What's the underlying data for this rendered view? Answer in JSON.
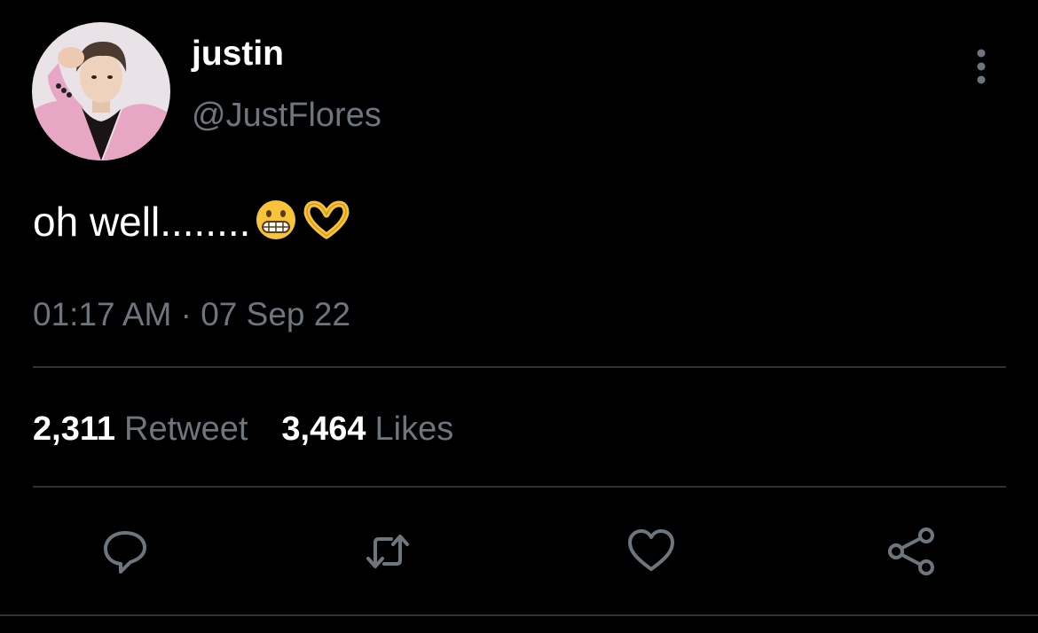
{
  "user": {
    "display_name": "justin",
    "handle": "@JustFlores"
  },
  "tweet": {
    "text": "oh well........",
    "emojis": [
      "grimacing-face-emoji",
      "heart-hands-emoji"
    ],
    "time": "01:17 AM",
    "separator": "·",
    "date": "07 Sep 22"
  },
  "stats": {
    "retweets_count": "2,311",
    "retweets_label": "Retweet",
    "likes_count": "3,464",
    "likes_label": "Likes"
  },
  "actions": {
    "icons": [
      "reply-icon",
      "retweet-icon",
      "like-icon",
      "share-icon"
    ]
  },
  "colors": {
    "background": "#000000",
    "primary_text": "#ffffff",
    "secondary_text": "#6e767d",
    "divider": "#2f3336",
    "emoji_yellow": "#f7c33a"
  }
}
